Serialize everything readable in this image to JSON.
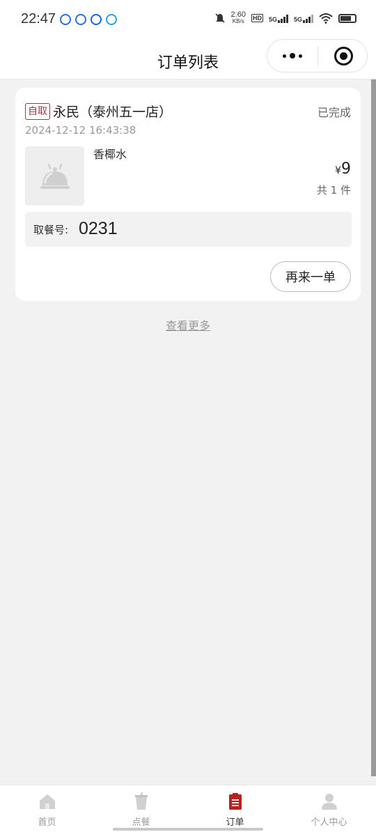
{
  "status_bar": {
    "time": "22:47",
    "net_speed": "2.60",
    "net_unit": "KB/s",
    "sig1": "5G",
    "sig2": "5G",
    "icons": [
      "app-icon",
      "baidu-icon",
      "browser-icon",
      "app-icon",
      "mute-icon",
      "hd-icon",
      "signal-icon",
      "wifi-icon",
      "battery-icon"
    ]
  },
  "nav": {
    "title": "订单列表"
  },
  "order": {
    "tag": "自取",
    "store": "永民（泰州五一店）",
    "status": "已完成",
    "time": "2024-12-12 16:43:38",
    "item_name": "香椰水",
    "currency": "¥",
    "price": "9",
    "count": "共 1 件",
    "pickup_label": "取餐号:",
    "pickup_code": "0231",
    "reorder_label": "再来一单"
  },
  "view_more": "查看更多",
  "tabs": [
    {
      "label": "首页",
      "icon": "home-icon"
    },
    {
      "label": "点餐",
      "icon": "drink-cup-icon"
    },
    {
      "label": "订单",
      "icon": "order-list-icon"
    },
    {
      "label": "个人中心",
      "icon": "user-icon"
    }
  ],
  "active_tab": "订单",
  "colors": {
    "accent": "#b3241e",
    "tag": "#a8323a",
    "background": "#f2f2f2"
  }
}
